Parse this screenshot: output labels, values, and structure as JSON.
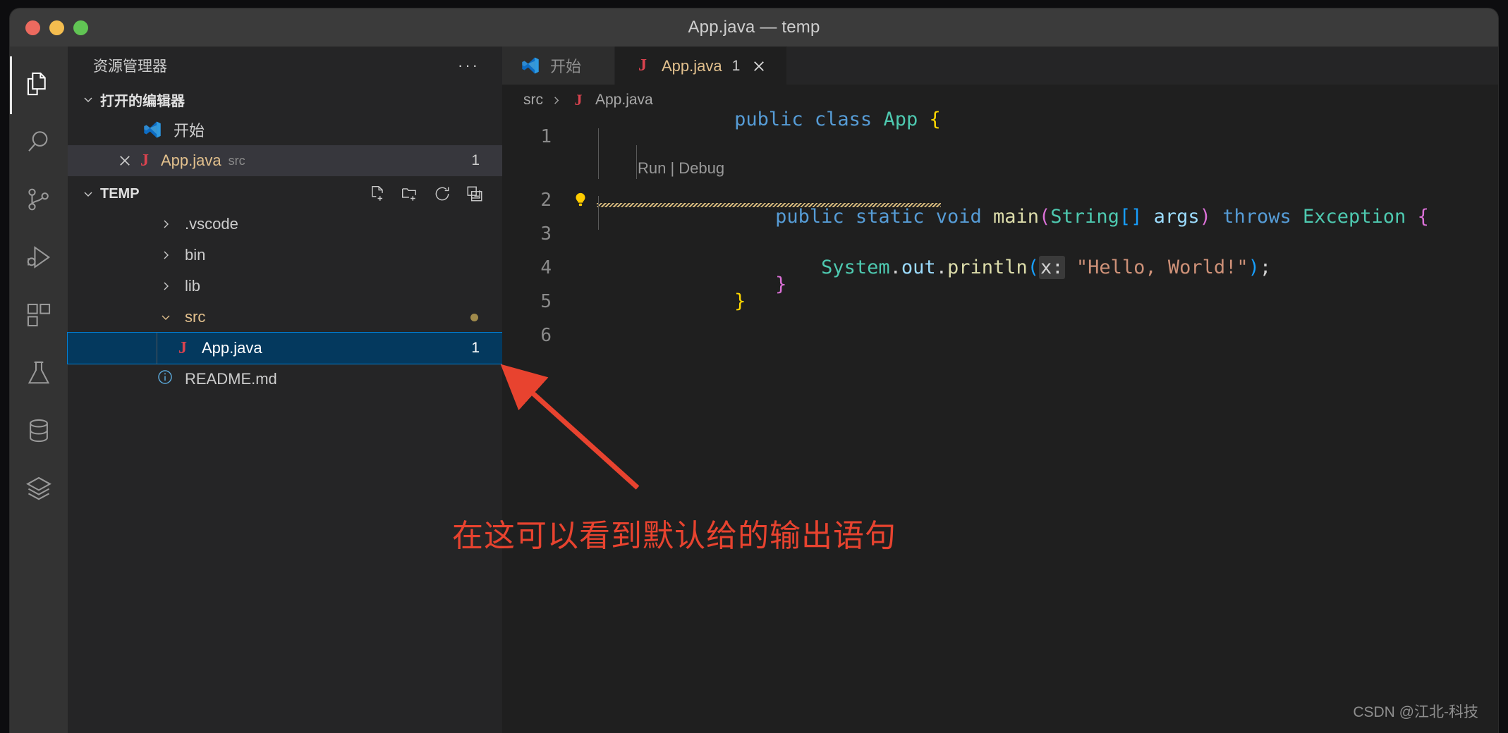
{
  "window": {
    "title": "App.java — temp",
    "traffic_lights": [
      "close",
      "minimize",
      "maximize"
    ]
  },
  "activitybar": {
    "items": [
      {
        "name": "explorer",
        "icon": "files-icon",
        "active": true
      },
      {
        "name": "search",
        "icon": "search-icon",
        "active": false
      },
      {
        "name": "source-control",
        "icon": "source-control-icon",
        "active": false
      },
      {
        "name": "run-and-debug",
        "icon": "run-debug-icon",
        "active": false
      },
      {
        "name": "extensions",
        "icon": "extensions-icon",
        "active": false
      },
      {
        "name": "testing",
        "icon": "beaker-icon",
        "active": false
      },
      {
        "name": "database",
        "icon": "database-icon",
        "active": false
      },
      {
        "name": "layers",
        "icon": "layers-icon",
        "active": false
      }
    ]
  },
  "sidebar": {
    "header": {
      "title": "资源管理器",
      "more_actions": "···"
    },
    "open_editors": {
      "label": "打开的编辑器",
      "expanded": true,
      "items": [
        {
          "label": "开始",
          "icon": "vscode-icon",
          "dirty": false,
          "badge": "",
          "description": ""
        },
        {
          "label": "App.java",
          "icon": "java-icon",
          "dirty": true,
          "badge": "1",
          "description": "src",
          "close": "×"
        }
      ]
    },
    "folder": {
      "label": "TEMP",
      "expanded": true,
      "actions": [
        {
          "name": "new-file-icon",
          "tooltip": "新建文件"
        },
        {
          "name": "new-folder-icon",
          "tooltip": "新建文件夹"
        },
        {
          "name": "refresh-icon",
          "tooltip": "刷新"
        },
        {
          "name": "collapse-all-icon",
          "tooltip": "折叠"
        }
      ],
      "tree": [
        {
          "label": ".vscode",
          "type": "folder",
          "expanded": false,
          "depth": 1,
          "modified": false
        },
        {
          "label": "bin",
          "type": "folder",
          "expanded": false,
          "depth": 1,
          "modified": false
        },
        {
          "label": "lib",
          "type": "folder",
          "expanded": false,
          "depth": 1,
          "modified": false
        },
        {
          "label": "src",
          "type": "folder",
          "expanded": true,
          "depth": 1,
          "modified": true,
          "dot": true
        },
        {
          "label": "App.java",
          "type": "java",
          "depth": 2,
          "selected": true,
          "badge": "1"
        },
        {
          "label": "README.md",
          "type": "markdown",
          "depth": 1,
          "modified": false
        }
      ]
    }
  },
  "editor": {
    "tabs": [
      {
        "label": "开始",
        "icon": "vscode-icon",
        "active": false,
        "badge": "",
        "closable": false
      },
      {
        "label": "App.java",
        "icon": "java-icon",
        "active": true,
        "badge": "1",
        "close": "×",
        "closable": true
      }
    ],
    "breadcrumb": [
      "src",
      "App.java"
    ],
    "breadcrumb_icon": "java-icon",
    "codelens": "Run | Debug",
    "lines": [
      {
        "number": "1"
      },
      {
        "number": "2"
      },
      {
        "number": "3"
      },
      {
        "number": "4"
      },
      {
        "number": "5"
      },
      {
        "number": "6"
      }
    ],
    "code": {
      "line1": {
        "kw1": "public",
        "kw2": "class",
        "type": "App",
        "brace": "{"
      },
      "line2": {
        "kw1": "public",
        "kw2": "static",
        "kw3": "void",
        "fn": "main",
        "lparen": "(",
        "type": "String",
        "brackets": "[]",
        "arg": "args",
        "rparen": ")",
        "kw4": "throws",
        "exc": "Exception",
        "brace": "{"
      },
      "line3": {
        "obj": "System",
        "dot1": ".",
        "field": "out",
        "dot2": ".",
        "method": "println",
        "lparen": "(",
        "inlay": "x:",
        "string": "\"Hello, World!\"",
        "rparen": ")",
        "semi": ";"
      },
      "line4": {
        "brace": "}"
      },
      "line5": {
        "brace": "}"
      }
    }
  },
  "annotation": {
    "text": "在这可以看到默认给的输出语句",
    "color": "#e8432f",
    "arrow": "points-up-left-to-editor"
  },
  "watermark": "CSDN @江北-科技",
  "colors": {
    "titlebar": "#3b3b3b",
    "activitybar": "#333333",
    "sidebar": "#252526",
    "editor": "#1f1f1f",
    "selection": "#04395e",
    "selection_border": "#007fd4",
    "open_editor_row": "#37373d",
    "modified_text": "#e2c08d",
    "java_icon": "#d9434f",
    "annotation": "#e8432f",
    "keyword": "#569cd6",
    "type": "#4ec9b0",
    "function": "#dcdcaa",
    "variable": "#9cdcfe",
    "string": "#ce9178",
    "bracket_yellow": "#ffd700",
    "bracket_magenta": "#da70d6",
    "bracket_blue": "#179fff"
  }
}
